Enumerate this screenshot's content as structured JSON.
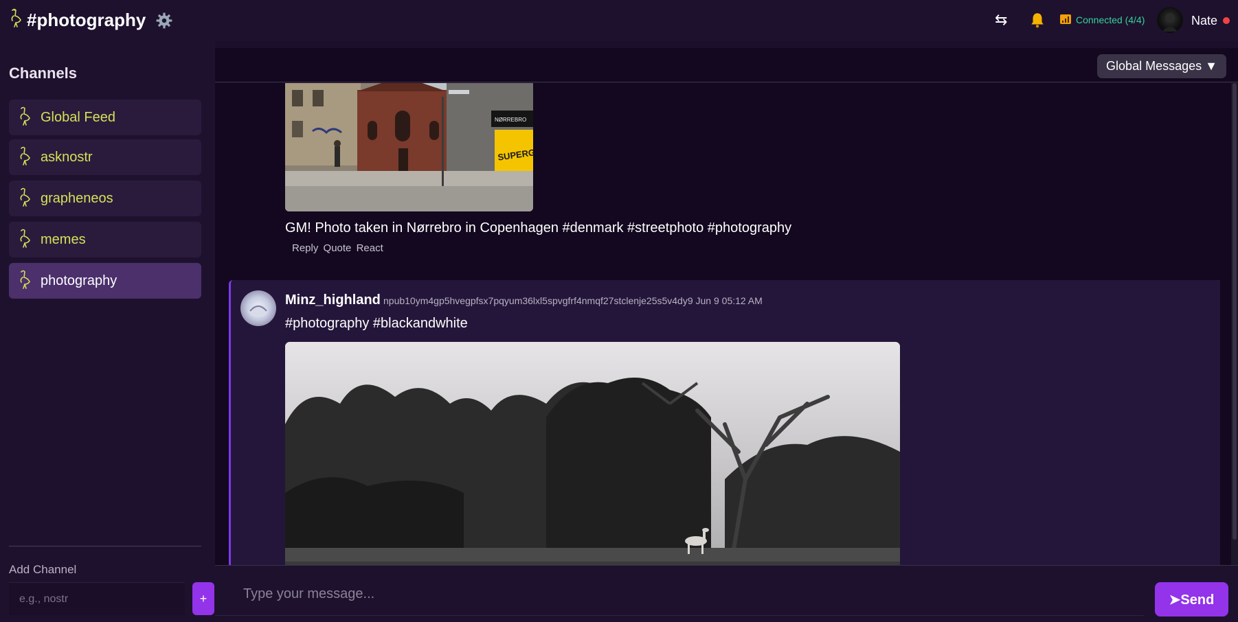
{
  "header": {
    "title": "#photography",
    "settings_icon": "gear-icon",
    "swap_glyph": "⇆",
    "status": "Connected (4/4)",
    "username": "Nate"
  },
  "sidebar": {
    "heading": "Channels",
    "channels": [
      {
        "label": "Global Feed",
        "active": false
      },
      {
        "label": "asknostr",
        "active": false
      },
      {
        "label": "grapheneos",
        "active": false
      },
      {
        "label": "memes",
        "active": false
      },
      {
        "label": "photography",
        "active": true
      }
    ],
    "add_label": "Add Channel",
    "add_placeholder": "e.g., nostr",
    "add_button": "+"
  },
  "feed": {
    "filter_button": "Global Messages ▼",
    "messages": [
      {
        "text": "GM! Photo taken in Nørrebro in Copenhagen #denmark #streetphoto #photography",
        "actions": [
          "Reply",
          "Quote",
          "React"
        ]
      },
      {
        "author": "Minz_highland",
        "pubkey": "npub10ym4gp5hvegpfsx7pqyum36lxl5spvgfrf4nmqf27stclenje25s5v4dy9",
        "time": "Jun 9 05:12 AM",
        "text": "#photography #blackandwhite"
      }
    ],
    "photo1_signs": [
      "NØRREBRO",
      "SUPERGAIN"
    ]
  },
  "composer": {
    "placeholder": "Type your message...",
    "send_label": "➤Send"
  },
  "colors": {
    "accent": "#9333ea",
    "channel_text": "#d4e157",
    "status_green": "#34d399",
    "online_dot": "#ef4444"
  }
}
